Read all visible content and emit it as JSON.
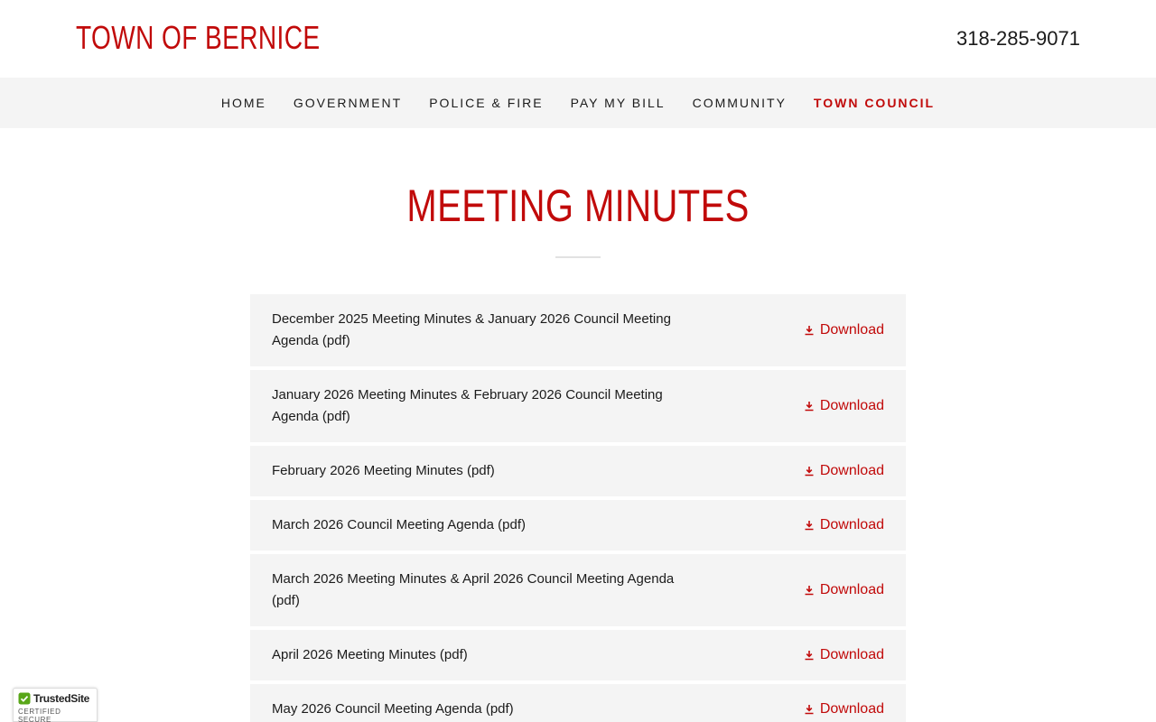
{
  "header": {
    "site_title": "TOWN OF BERNICE",
    "phone": "318-285-9071"
  },
  "nav": {
    "items": [
      {
        "label": "HOME"
      },
      {
        "label": "GOVERNMENT"
      },
      {
        "label": "POLICE & FIRE"
      },
      {
        "label": "PAY MY BILL"
      },
      {
        "label": "COMMUNITY"
      },
      {
        "label": "TOWN COUNCIL",
        "active": true
      }
    ]
  },
  "page": {
    "title": "MEETING MINUTES"
  },
  "documents": {
    "download_label": "Download",
    "items": [
      {
        "title": "December 2025 Meeting Minutes & January 2026 Council Meeting Agenda (pdf)"
      },
      {
        "title": "January 2026 Meeting Minutes & February 2026 Council Meeting Agenda (pdf)"
      },
      {
        "title": "February 2026 Meeting Minutes (pdf)"
      },
      {
        "title": "March 2026 Council Meeting Agenda (pdf)"
      },
      {
        "title": "March 2026 Meeting Minutes & April 2026 Council Meeting Agenda (pdf)"
      },
      {
        "title": "April 2026 Meeting Minutes (pdf)"
      },
      {
        "title": "May 2026 Council Meeting Agenda (pdf)"
      }
    ]
  },
  "badge": {
    "name": "TrustedSite",
    "sub": "CERTIFIED SECURE"
  },
  "colors": {
    "accent": "#c10a0a",
    "nav_background": "#f4f4f4",
    "row_background": "#f4f4f4",
    "text": "#1b1b1b"
  },
  "icons": {
    "download": "download-icon",
    "badge": "checkmark-icon"
  }
}
